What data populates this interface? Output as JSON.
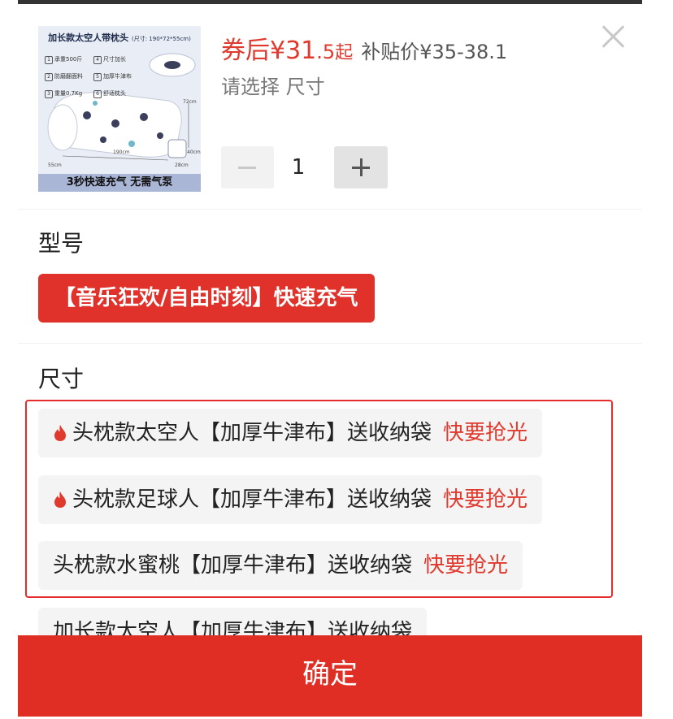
{
  "product": {
    "image_title": "加长款太空人带枕头",
    "image_spec": "(尺寸: 190*72*55cm)",
    "image_features": [
      "承重500斤",
      "尺寸加长",
      "防磨翻面料",
      "加厚牛津布",
      "重量0.7Kg",
      "舒适枕头"
    ],
    "image_feature_nums": [
      "1",
      "4",
      "2",
      "5",
      "3",
      "6"
    ],
    "image_dims": {
      "h": "72cm",
      "l": "190cm",
      "w": "55cm",
      "bag_h": "40cm",
      "bag_w": "28cm"
    },
    "image_banner": "3秒快速充气 无需气泵"
  },
  "price": {
    "prefix": "券后¥",
    "integer": "31",
    "decimal": ".5",
    "suffix": "起",
    "subsidy": "补贴价¥35-38.1"
  },
  "select_hint": "请选择 尺寸",
  "quantity": {
    "value": "1"
  },
  "model": {
    "title": "型号",
    "options": [
      {
        "label": "【音乐狂欢/自由时刻】快速充气",
        "selected": true
      }
    ]
  },
  "size": {
    "title": "尺寸",
    "options": [
      {
        "label": "头枕款太空人【加厚牛津布】送收纳袋",
        "tag": "快要抢光",
        "hot": true
      },
      {
        "label": "头枕款足球人【加厚牛津布】送收纳袋",
        "tag": "快要抢光",
        "hot": true
      },
      {
        "label": "头枕款水蜜桃【加厚牛津布】送收纳袋",
        "tag": "快要抢光",
        "hot": false
      },
      {
        "label": "加长款太空人【加厚牛津布】送收纳袋",
        "tag": "",
        "hot": false
      }
    ]
  },
  "confirm_label": "确定",
  "colors": {
    "accent": "#e02e24",
    "price": "#e03a2e",
    "highlight": "#e52b2b"
  }
}
